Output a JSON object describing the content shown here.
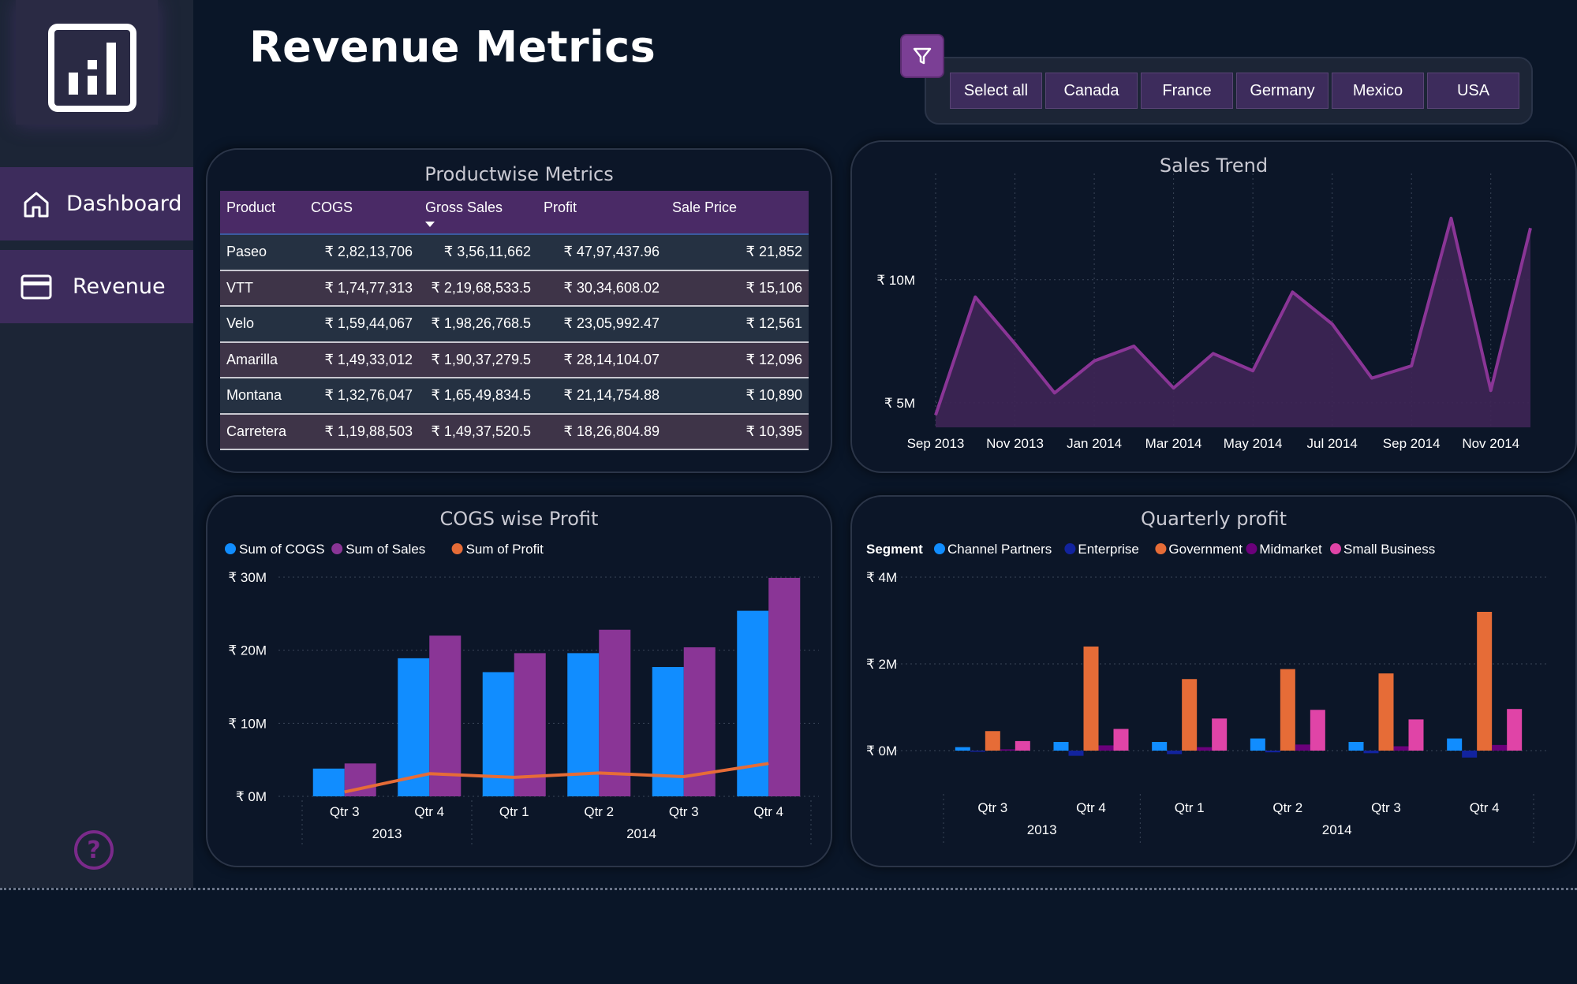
{
  "page": {
    "title": "Revenue Metrics"
  },
  "sidebar": {
    "logo_icon": "bar-chart-icon",
    "items": [
      {
        "label": "Dashboard",
        "icon": "home-icon"
      },
      {
        "label": "Revenue",
        "icon": "credit-card-icon"
      }
    ],
    "help_icon": "help-icon",
    "help_glyph": "?"
  },
  "filter": {
    "icon": "funnel-icon",
    "options": [
      "Select all",
      "Canada",
      "France",
      "Germany",
      "Mexico",
      "USA"
    ]
  },
  "colors": {
    "background": "#0a1628",
    "sidebar": "#1c2536",
    "accent_purple": "#8a3596",
    "blue": "#118dff",
    "orange": "#e66c37",
    "dark_blue": "#12239e",
    "dark_purple": "#6b007b",
    "pink": "#e044a7"
  },
  "productwise_metrics": {
    "title": "Productwise Metrics",
    "columns": [
      "Product",
      "COGS",
      "Gross Sales",
      "Profit",
      "Sale Price"
    ],
    "rows": [
      [
        "Paseo",
        "₹ 2,82,13,706",
        "₹ 3,56,11,662",
        "₹ 47,97,437.96",
        "₹ 21,852"
      ],
      [
        "VTT",
        "₹ 1,74,77,313",
        "₹ 2,19,68,533.5",
        "₹ 30,34,608.02",
        "₹ 15,106"
      ],
      [
        "Velo",
        "₹ 1,59,44,067",
        "₹ 1,98,26,768.5",
        "₹ 23,05,992.47",
        "₹ 12,561"
      ],
      [
        "Amarilla",
        "₹ 1,49,33,012",
        "₹ 1,90,37,279.5",
        "₹ 28,14,104.07",
        "₹ 12,096"
      ],
      [
        "Montana",
        "₹ 1,32,76,047",
        "₹ 1,65,49,834.5",
        "₹ 21,14,754.88",
        "₹ 10,890"
      ],
      [
        "Carretera",
        "₹ 1,19,88,503",
        "₹ 1,49,37,520.5",
        "₹ 18,26,804.89",
        "₹ 10,395"
      ]
    ]
  },
  "chart_data": [
    {
      "type": "area",
      "title": "Sales Trend",
      "x": [
        "Sep 2013",
        "Oct 2013",
        "Nov 2013",
        "Dec 2013",
        "Jan 2014",
        "Feb 2014",
        "Mar 2014",
        "Apr 2014",
        "May 2014",
        "Jun 2014",
        "Jul 2014",
        "Aug 2014",
        "Sep 2014",
        "Oct 2014",
        "Nov 2014",
        "Dec 2014"
      ],
      "x_ticks": [
        "Sep 2013",
        "Nov 2013",
        "Jan 2014",
        "Mar 2014",
        "May 2014",
        "Jul 2014",
        "Sep 2014",
        "Nov 2014"
      ],
      "values": [
        4.5,
        9.3,
        7.4,
        5.4,
        6.7,
        7.3,
        5.6,
        7.0,
        6.3,
        9.5,
        8.2,
        6.0,
        6.5,
        12.5,
        5.5,
        12.1
      ],
      "y_ticks": [
        "₹ 5M",
        "₹ 10M"
      ],
      "y_tick_values": [
        5,
        10
      ],
      "ylim": [
        4,
        14
      ],
      "grid": true
    },
    {
      "type": "bar",
      "title": "COGS wise Profit",
      "categories": [
        "Qtr 3",
        "Qtr 4",
        "Qtr 1",
        "Qtr 2",
        "Qtr 3",
        "Qtr 4"
      ],
      "groups": [
        {
          "label": "2013",
          "count": 2
        },
        {
          "label": "2014",
          "count": 4
        }
      ],
      "series": [
        {
          "name": "Sum of  COGS",
          "type": "bar",
          "values": [
            3.8,
            18.9,
            17.0,
            19.6,
            17.7,
            25.4
          ]
        },
        {
          "name": "Sum of   Sales",
          "type": "bar",
          "values": [
            4.5,
            22.0,
            19.6,
            22.8,
            20.4,
            29.9
          ]
        },
        {
          "name": "Sum of  Profit",
          "type": "line",
          "values": [
            0.6,
            3.1,
            2.6,
            3.2,
            2.7,
            4.5
          ]
        }
      ],
      "y_ticks": [
        "₹ 0M",
        "₹ 10M",
        "₹ 20M",
        "₹ 30M"
      ],
      "y_tick_values": [
        0,
        10,
        20,
        30
      ],
      "ylim": [
        0,
        30
      ],
      "legend": "top-left",
      "grid": true
    },
    {
      "type": "bar",
      "title": "Quarterly profit",
      "legend_title": "Segment",
      "categories": [
        "Qtr 3",
        "Qtr 4",
        "Qtr 1",
        "Qtr 2",
        "Qtr 3",
        "Qtr 4"
      ],
      "groups": [
        {
          "label": "2013",
          "count": 2
        },
        {
          "label": "2014",
          "count": 4
        }
      ],
      "series": [
        {
          "name": "Channel Partners",
          "values": [
            0.08,
            0.2,
            0.2,
            0.28,
            0.2,
            0.28
          ]
        },
        {
          "name": "Enterprise",
          "values": [
            -0.02,
            -0.12,
            -0.08,
            -0.04,
            -0.06,
            -0.16
          ]
        },
        {
          "name": "Government",
          "values": [
            0.45,
            2.4,
            1.65,
            1.88,
            1.78,
            3.2
          ]
        },
        {
          "name": "Midmarket",
          "values": [
            0.03,
            0.12,
            0.08,
            0.14,
            0.1,
            0.13
          ]
        },
        {
          "name": "Small Business",
          "values": [
            0.22,
            0.5,
            0.74,
            0.94,
            0.72,
            0.96
          ]
        }
      ],
      "y_ticks": [
        "₹ 0M",
        "₹ 2M",
        "₹ 4M"
      ],
      "y_tick_values": [
        0,
        2,
        4
      ],
      "ylim": [
        -0.3,
        4
      ],
      "legend": "top-left",
      "grid": true
    }
  ]
}
